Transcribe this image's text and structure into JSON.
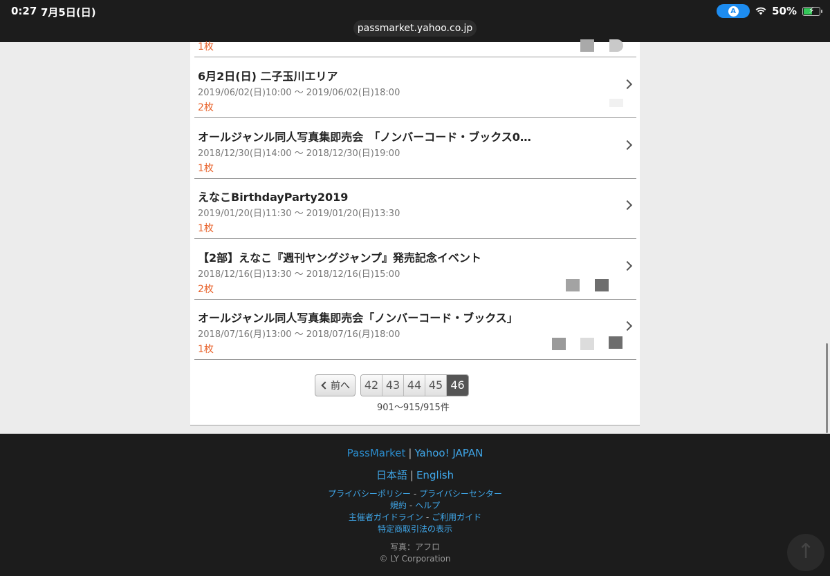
{
  "status_bar": {
    "time": "0:27",
    "date": "7月5日(日)",
    "battery": "50%",
    "url": "passmarket.yahoo.co.jp",
    "navigation_badge": "A"
  },
  "events": [
    {
      "title": "",
      "date": "",
      "count": "1枚"
    },
    {
      "title": "6月2日(日) 二子玉川エリア",
      "date": "2019/06/02(日)10:00 〜 2019/06/02(日)18:00",
      "count": "2枚"
    },
    {
      "title": "オールジャンル同人写真集即売会　「ノンバーコード・ブックス0…",
      "date": "2018/12/30(日)14:00 〜 2018/12/30(日)19:00",
      "count": "1枚"
    },
    {
      "title": "えなこBirthdayParty2019",
      "date": "2019/01/20(日)11:30 〜 2019/01/20(日)13:30",
      "count": "1枚"
    },
    {
      "title": "【2部】えなこ『週刊ヤングジャンプ』発売記念イベント",
      "date": "2018/12/16(日)13:30 〜 2018/12/16(日)15:00",
      "count": "2枚"
    },
    {
      "title": "オールジャンル同人写真集即売会「ノンバーコード・ブックス」",
      "date": "2018/07/16(月)13:00 〜 2018/07/16(月)18:00",
      "count": "1枚"
    }
  ],
  "pagination": {
    "prev_label": "前へ",
    "pages": [
      "42",
      "43",
      "44",
      "45",
      "46"
    ],
    "current": "46",
    "range": "901〜915/915件"
  },
  "footer": {
    "passmarket": "PassMarket",
    "yahoo_japan": "Yahoo! JAPAN",
    "lang_ja": "日本語",
    "lang_en": "English",
    "privacy_policy": "プライバシーポリシー",
    "privacy_center": "プライバシーセンター",
    "terms": "規約",
    "help": "ヘルプ",
    "organizer_guidelines": "主催者ガイドライン",
    "user_guide": "ご利用ガイド",
    "commercial_law": "特定商取引法の表示",
    "photo_credit": "写真：アフロ",
    "copyright": "© LY Corporation"
  }
}
